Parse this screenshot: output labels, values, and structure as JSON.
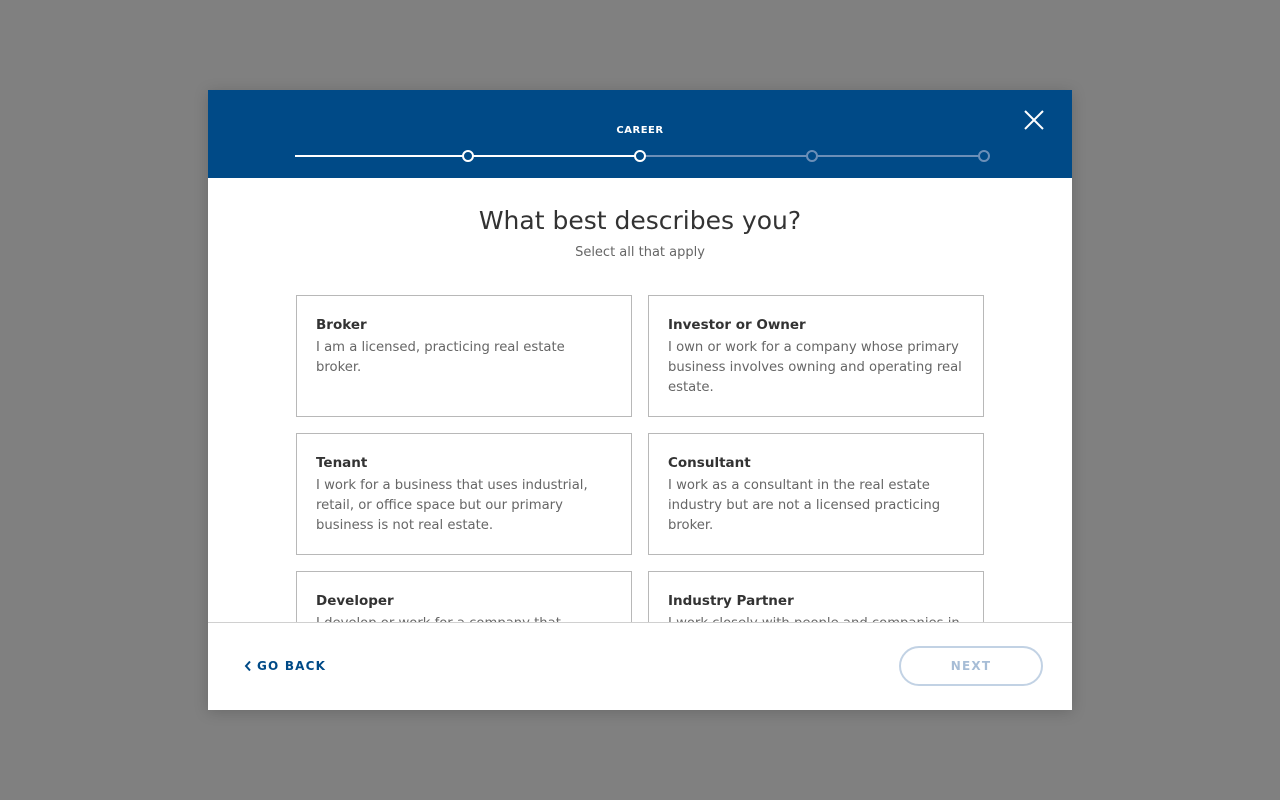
{
  "header": {
    "step_label": "CAREER",
    "close_icon": "close-icon",
    "colors": {
      "header_bg": "#004a87",
      "completed": "#ffffff",
      "upcoming": "#6b8fb8"
    },
    "progress": {
      "total_steps": 5,
      "current_step": 3
    }
  },
  "body": {
    "title": "What best describes you?",
    "subtitle": "Select all that apply",
    "options": [
      {
        "title": "Broker",
        "description": "I am a licensed, practicing real estate broker."
      },
      {
        "title": "Investor or Owner",
        "description": "I own or work for a company whose primary business involves owning and operating real estate."
      },
      {
        "title": "Tenant",
        "description": "I work for a business that uses industrial, retail, or office space but our primary business is not real estate."
      },
      {
        "title": "Consultant",
        "description": "I work as a consultant in the real estate industry but are not a licensed practicing broker."
      },
      {
        "title": "Developer",
        "description": "I develop or work for a company that"
      },
      {
        "title": "Industry Partner",
        "description": "I work closely with people and companies in"
      }
    ]
  },
  "footer": {
    "back_label": "GO BACK",
    "back_icon": "chevron-left-icon",
    "next_label": "NEXT"
  }
}
